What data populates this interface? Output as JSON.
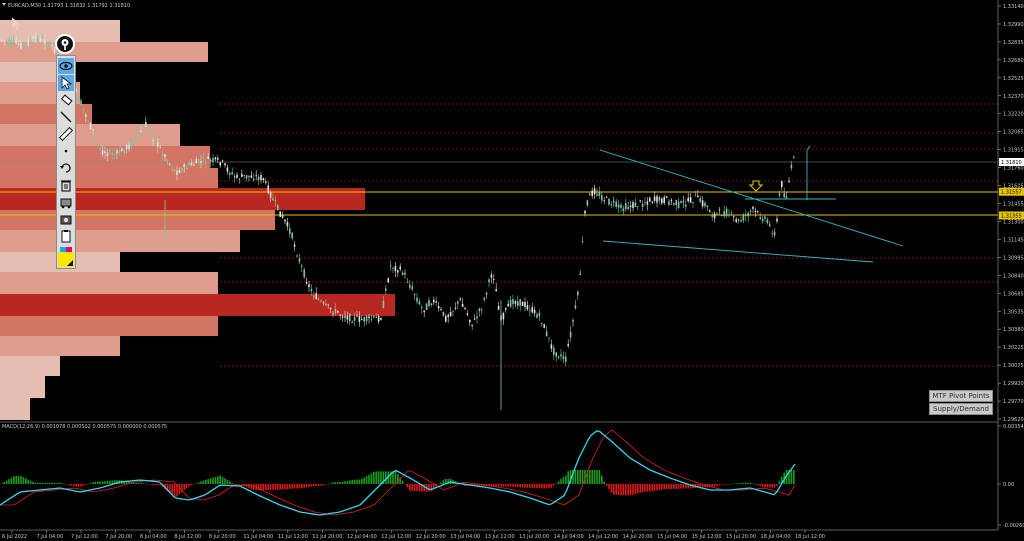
{
  "window": {
    "symbol_info": "EURCAD,M30  1.31793  1.31832  1.31792  1.31810"
  },
  "macd": {
    "label": "MACD(12,26,9) 0.001078 0.000502 0.000575 0.000000 0.000575",
    "axis_labels": [
      "0.003546",
      "0.00",
      "-0.002603"
    ]
  },
  "price_axis": {
    "labels": [
      "1.33140",
      "1.32990",
      "1.32835",
      "1.32680",
      "1.32525",
      "1.32370",
      "1.32220",
      "1.32065",
      "1.31915",
      "1.31760",
      "1.31605",
      "1.31455",
      "1.31300",
      "1.31145",
      "1.30995",
      "1.30840",
      "1.30685",
      "1.30535",
      "1.30380",
      "1.30225",
      "1.30075",
      "1.29920",
      "1.29770",
      "1.29620"
    ],
    "current_price": "1.31810",
    "yellow_tag_upper": "1.31557",
    "yellow_tag_lower": "1.31355"
  },
  "time_axis": {
    "labels": [
      "6 Jul 2022",
      "7 Jul 04:00",
      "7 Jul 12:00",
      "7 Jul 20:00",
      "8 Jul 04:00",
      "8 Jul 12:00",
      "8 Jul 20:00",
      "11 Jul 04:00",
      "11 Jul 12:00",
      "11 Jul 20:00",
      "12 Jul 04:00",
      "12 Jul 12:00",
      "12 Jul 20:00",
      "13 Jul 04:00",
      "13 Jul 12:00",
      "13 Jul 20:00",
      "14 Jul 04:00",
      "14 Jul 12:00",
      "14 Jul 20:00",
      "15 Jul 04:00",
      "15 Jul 12:00",
      "15 Jul 20:00",
      "18 Jul 04:00",
      "18 Jul 12:00"
    ]
  },
  "buttons": {
    "mtf_pivot_points": "MTF Pivot Points",
    "supply_demand": "Supply/Demand"
  },
  "toolbar": {
    "items": [
      "eye-icon",
      "cursor-icon",
      "eraser-icon",
      "line-icon",
      "ruler-icon",
      "dot-icon",
      "undo-icon",
      "trash-icon",
      "tray-icon",
      "camera-icon",
      "clipboard-icon",
      "color-palette-icon",
      "highlight-icon"
    ]
  },
  "colors": {
    "background": "#000000",
    "bull_candle": "#7dc8a0",
    "bear_candle": "#e0e0e0",
    "trendline": "#33b8c8",
    "macd_line": "#33d8f0",
    "signal_line": "#e02020",
    "hist_up": "#19a019",
    "hist_down": "#e01818",
    "yellow_line": "#e6c200",
    "volume_profile": [
      "#f2c7bb",
      "#e9a493",
      "#de7b69",
      "#c32a22"
    ]
  }
}
